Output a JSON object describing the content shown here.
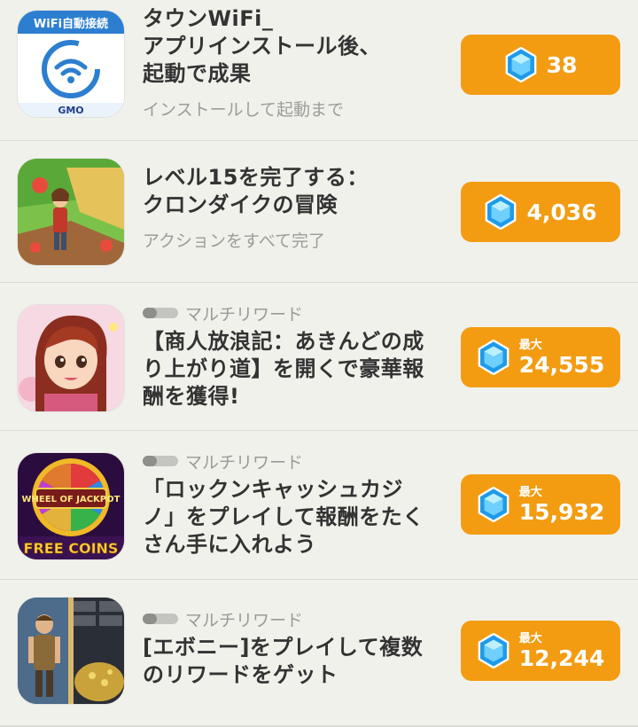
{
  "rewards_list": [
    {
      "icon": "wifi-app-icon",
      "icon_caption": "WiFi自動接続",
      "icon_brand": "GMO",
      "multi_label": "",
      "title": "タウンWiFi_\nアプリインストール後、\n起動で成果",
      "subtitle": "インストールして起動まで",
      "max_label": "",
      "amount": "38"
    },
    {
      "icon": "klondike-farm-icon",
      "multi_label": "",
      "title": "レベル15を完了する：\nクロンダイクの冒険",
      "subtitle": "アクションをすべて完了",
      "max_label": "",
      "amount": "4,036"
    },
    {
      "icon": "merchant-girl-icon",
      "multi_label": "マルチリワード",
      "title": "【商人放浪記：あきんどの成\nり上がり道】を開くで豪華報\n酬を獲得!",
      "subtitle": "",
      "max_label": "最大",
      "amount": "24,555"
    },
    {
      "icon": "jackpot-slots-icon",
      "icon_caption": "FREE COINS",
      "multi_label": "マルチリワード",
      "title": "「ロックンキャッシュカジ\nノ」をプレイして報酬をたく\nさん手に入れよう",
      "subtitle": "",
      "max_label": "最大",
      "amount": "15,932"
    },
    {
      "icon": "ebony-warrior-icon",
      "multi_label": "マルチリワード",
      "title": "[エボニー]をプレイして複数\nのリワードをゲット",
      "subtitle": "",
      "max_label": "最大",
      "amount": "12,244"
    }
  ],
  "colors": {
    "reward_button": "#f39c12",
    "gem": "#1e9be8",
    "background": "#f1f1ec"
  }
}
